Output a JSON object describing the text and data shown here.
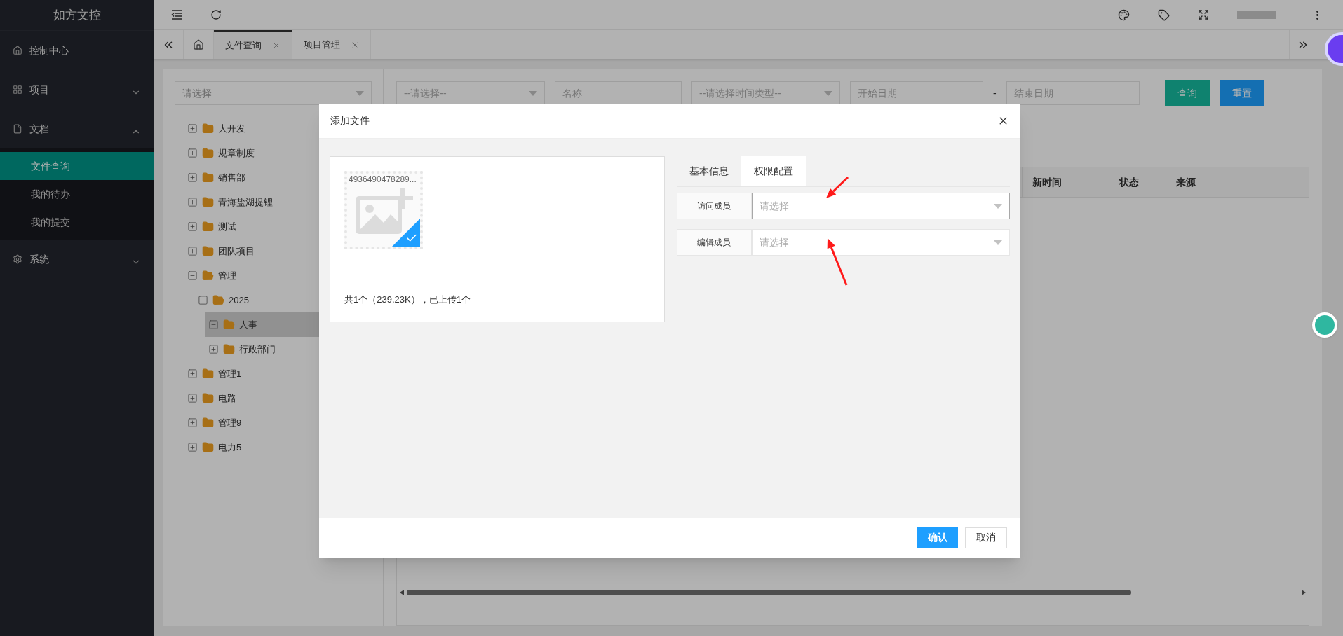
{
  "sidebar": {
    "logo": "如方文控",
    "items": [
      {
        "label": "控制中心"
      },
      {
        "label": "项目",
        "expanded": false
      },
      {
        "label": "文档",
        "expanded": true,
        "children": [
          {
            "label": "文件查询",
            "selected": true
          },
          {
            "label": "我的待办",
            "selected": false
          },
          {
            "label": "我的提交",
            "selected": false
          }
        ]
      },
      {
        "label": "系统",
        "expanded": false
      }
    ]
  },
  "tabs": [
    {
      "label": "文件查询",
      "selected": true
    },
    {
      "label": "项目管理",
      "selected": false
    }
  ],
  "tree_select": {
    "placeholder": "请选择"
  },
  "tree": [
    {
      "label": "大开发",
      "expanded": false,
      "selected": false
    },
    {
      "label": "规章制度",
      "expanded": false,
      "selected": false
    },
    {
      "label": "销售部",
      "expanded": false,
      "selected": false
    },
    {
      "label": "青海盐湖提锂",
      "expanded": false,
      "selected": false
    },
    {
      "label": "测试",
      "expanded": false,
      "selected": false
    },
    {
      "label": "团队项目",
      "expanded": false,
      "selected": false
    },
    {
      "label": "管理",
      "expanded": true,
      "selected": false,
      "children": [
        {
          "label": "2025",
          "expanded": true,
          "selected": false,
          "children": [
            {
              "label": "人事",
              "expanded": true,
              "selected": true
            },
            {
              "label": "行政部门",
              "expanded": false,
              "selected": false
            }
          ]
        }
      ]
    },
    {
      "label": "管理1",
      "expanded": false,
      "selected": false
    },
    {
      "label": "电路",
      "expanded": false,
      "selected": false
    },
    {
      "label": "管理9",
      "expanded": false,
      "selected": false
    },
    {
      "label": "电力5",
      "expanded": false,
      "selected": false
    }
  ],
  "filters": [
    {
      "kind": "select",
      "placeholder": "--请选择--"
    },
    {
      "kind": "input",
      "placeholder": "名称"
    },
    {
      "kind": "select",
      "placeholder": "--请选择时间类型--"
    },
    {
      "kind": "input",
      "placeholder": "开始日期"
    },
    {
      "kind": "separator",
      "text": "-"
    },
    {
      "kind": "input",
      "placeholder": "结束日期"
    }
  ],
  "filter_buttons": [
    {
      "label": "查询",
      "kind": "primary"
    },
    {
      "label": "重置",
      "kind": "secondary"
    }
  ],
  "table": {
    "columns": [
      "新时间",
      "状态",
      "来源"
    ]
  },
  "dialog": {
    "title": "添加文件",
    "file": {
      "name": "4936490478289...",
      "selected": true
    },
    "summary": "共1个（239.23K），已上传1个",
    "tabs": [
      {
        "label": "基本信息",
        "selected": false
      },
      {
        "label": "权限配置",
        "selected": true
      }
    ],
    "fields": [
      {
        "label": "访问成员",
        "placeholder": "请选择",
        "focused": true
      },
      {
        "label": "编辑成员",
        "placeholder": "请选择",
        "focused": false
      }
    ],
    "buttons": [
      {
        "label": "确认",
        "kind": "primary"
      },
      {
        "label": "取消",
        "kind": "default"
      }
    ]
  }
}
